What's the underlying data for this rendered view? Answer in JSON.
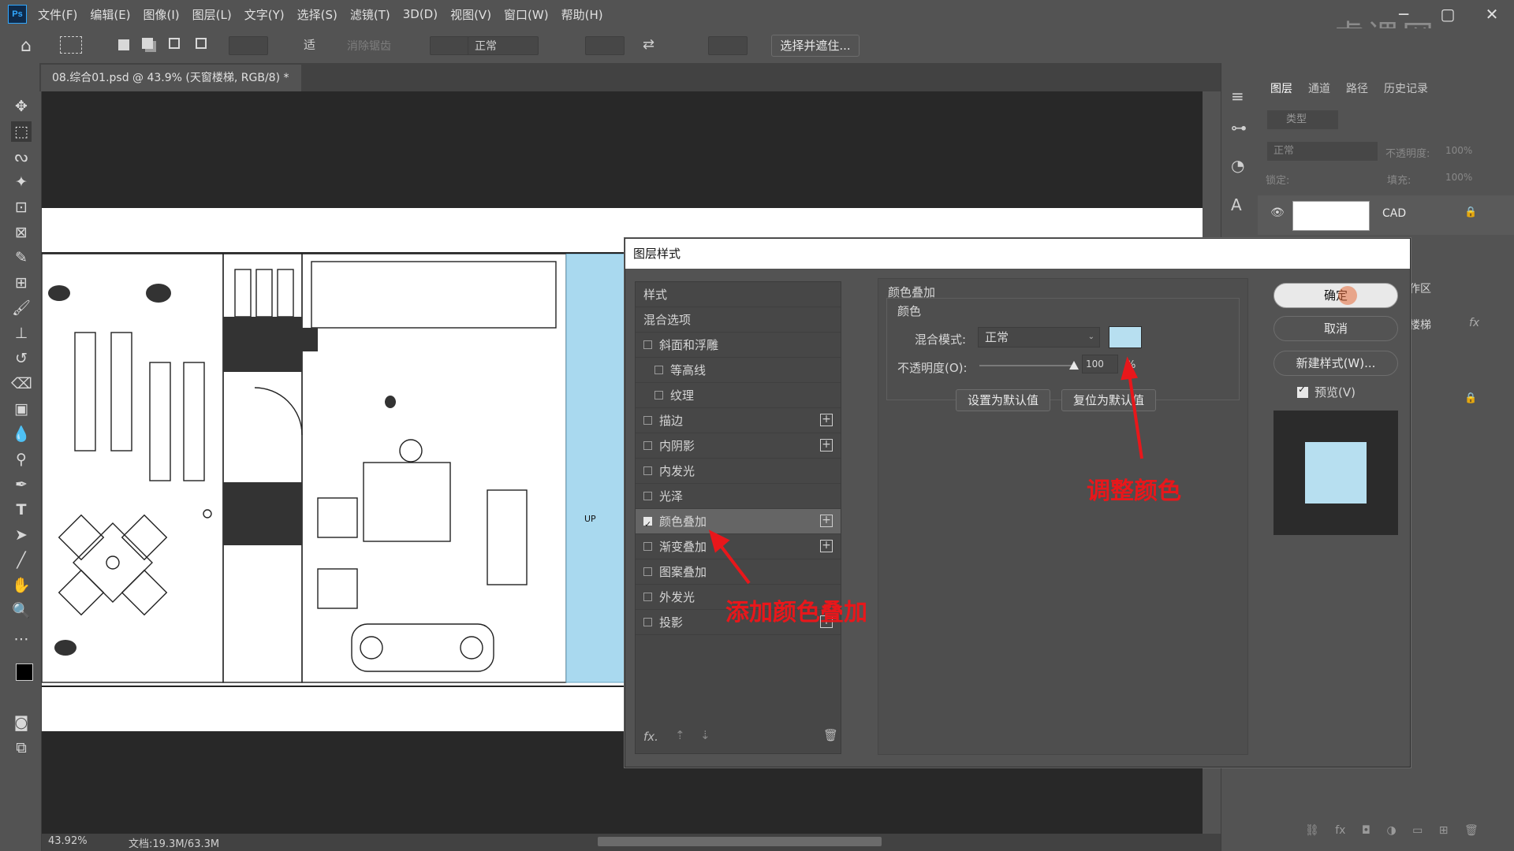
{
  "menubar": {
    "logo": "Ps",
    "items": [
      "文件(F)",
      "编辑(E)",
      "图像(I)",
      "图层(L)",
      "文字(Y)",
      "选择(S)",
      "滤镜(T)",
      "3D(D)",
      "视图(V)",
      "窗口(W)",
      "帮助(H)"
    ]
  },
  "watermark": "虎课网",
  "options": {
    "feather_label": "适",
    "antialias": "消除锯齿",
    "style_value": "正常",
    "select_mask_button": "选择并遮住..."
  },
  "document_tab": {
    "title": "08.综合01.psd @ 43.9% (天窗楼梯, RGB/8) *",
    "close": "×"
  },
  "statusbar": {
    "zoom": "43.92%",
    "doc_info": "文档:19.3M/63.3M"
  },
  "plan": {
    "stair_label": "UP"
  },
  "layers_panel": {
    "tabs": [
      "图层",
      "通道",
      "路径",
      "历史记录"
    ],
    "filter_label": "类型",
    "blend_mode": "正常",
    "opacity_label": "不透明度:",
    "opacity_value": "100%",
    "lock_label": "锁定:",
    "fill_label": "填充:",
    "fill_value": "100%",
    "layers": [
      {
        "name": "CAD"
      },
      {
        "name": "作区"
      },
      {
        "name": "楼梯"
      }
    ]
  },
  "dialog": {
    "title": "图层样式",
    "styles": [
      {
        "label": "样式",
        "checkbox": false,
        "plus": false,
        "checked": false
      },
      {
        "label": "混合选项",
        "checkbox": false,
        "plus": false,
        "checked": false
      },
      {
        "label": "斜面和浮雕",
        "checkbox": true,
        "plus": false,
        "checked": false
      },
      {
        "label": "等高线",
        "checkbox": true,
        "plus": false,
        "checked": false,
        "indent": true
      },
      {
        "label": "纹理",
        "checkbox": true,
        "plus": false,
        "checked": false,
        "indent": true
      },
      {
        "label": "描边",
        "checkbox": true,
        "plus": true,
        "checked": false
      },
      {
        "label": "内阴影",
        "checkbox": true,
        "plus": true,
        "checked": false
      },
      {
        "label": "内发光",
        "checkbox": true,
        "plus": false,
        "checked": false
      },
      {
        "label": "光泽",
        "checkbox": true,
        "plus": false,
        "checked": false
      },
      {
        "label": "颜色叠加",
        "checkbox": true,
        "plus": true,
        "checked": true,
        "selected": true
      },
      {
        "label": "渐变叠加",
        "checkbox": true,
        "plus": true,
        "checked": false
      },
      {
        "label": "图案叠加",
        "checkbox": true,
        "plus": false,
        "checked": false
      },
      {
        "label": "外发光",
        "checkbox": true,
        "plus": false,
        "checked": false
      },
      {
        "label": "投影",
        "checkbox": true,
        "plus": true,
        "checked": false
      }
    ],
    "footer_fx": "fx.",
    "section_title": "颜色叠加",
    "subsection": "颜色",
    "blend_label": "混合模式:",
    "blend_value": "正常",
    "overlay_color": "#b7dff0",
    "opacity_label": "不透明度(O):",
    "opacity_value": "100",
    "opacity_level": 1.0,
    "percent": "%",
    "set_default": "设置为默认值",
    "reset_default": "复位为默认值",
    "ok": "确定",
    "cancel": "取消",
    "new_style": "新建样式(W)...",
    "preview_label": "预览(V)",
    "preview_checked": true
  },
  "annotations": {
    "add_overlay": "添加颜色叠加",
    "adjust_color": "调整颜色",
    "color": "#e8171b"
  }
}
